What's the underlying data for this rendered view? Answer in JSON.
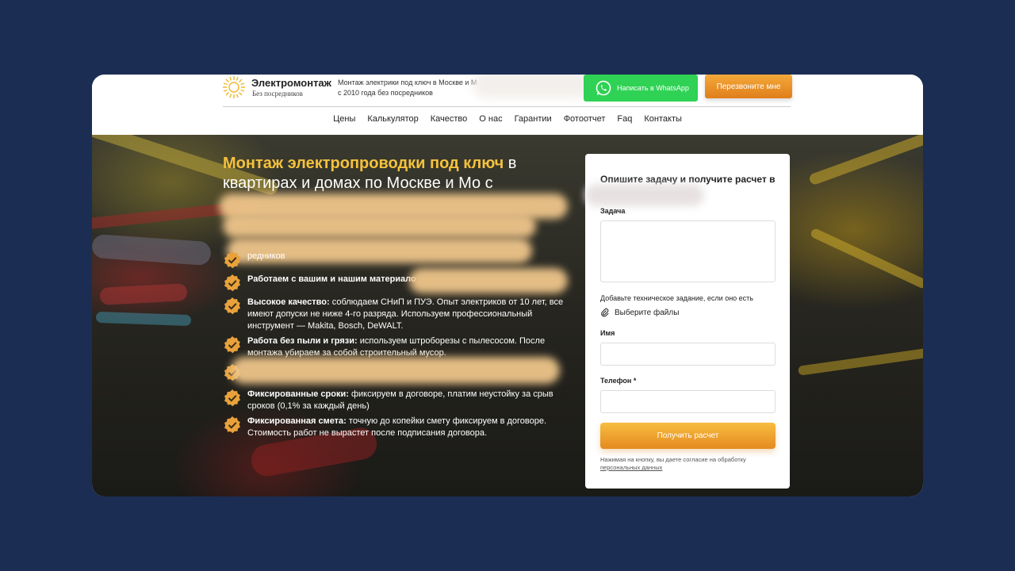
{
  "header": {
    "brand_name": "Электромонтаж",
    "brand_sub": "Без посредников",
    "tagline_line1": "Монтаж электрики под ключ в Москве и М",
    "tagline_line2": "с 2010 года без посредников",
    "whatsapp_label": "Написать в WhatsApp",
    "callback_label": "Перезвоните мне"
  },
  "nav": [
    "Цены",
    "Калькулятор",
    "Качество",
    "О нас",
    "Гарантии",
    "Фотоотчет",
    "Faq",
    "Контакты"
  ],
  "hero": {
    "title_accent": "Монтаж электропроводки под ключ",
    "title_rest_1": " в",
    "title_rest_2": "квартирах и домах по Москве и Мо с",
    "features": [
      {
        "bold": "",
        "text": "редников"
      },
      {
        "bold": "Работаем с вашим и нашим материало",
        "text": ""
      },
      {
        "bold": "Высокое качество:",
        "text": " соблюдаем СНиП и ПУЭ. Опыт электриков от 10 лет, все имеют допуски не ниже 4-го разряда. Используем профессиональный инструмент — Makita, Bosch, DeWALT."
      },
      {
        "bold": "Работа без пыли и грязи:",
        "text": " используем штроборезы с пылесосом. После монтажа убираем за собой строительный мусор."
      },
      {
        "bold": "",
        "text": ""
      },
      {
        "bold": "Фиксированные сроки:",
        "text": " фиксируем в договоре, платим неустойку за срыв сроков (0,1% за каждый день)"
      },
      {
        "bold": "Фиксированная смета:",
        "text": " точную до копейки смету фиксируем в договоре. Стоимость работ не вырастет после подписания договора."
      }
    ]
  },
  "form": {
    "title": "Опишите задачу и получите расчет в",
    "task_label": "Задача",
    "hint": "Добавьте техническое задание, если оно есть",
    "file_label": "Выберите файлы",
    "name_label": "Имя",
    "phone_label": "Телефон *",
    "submit_label": "Получить расчет",
    "consent_text": "Нажимая на кнопку, вы даете согласие на обработку ",
    "consent_link": "персональных данных"
  },
  "colors": {
    "accent_yellow": "#f5c23c",
    "whatsapp_green": "#2fd254",
    "orange": "#e58a20",
    "page_bg": "#1b2d52"
  }
}
